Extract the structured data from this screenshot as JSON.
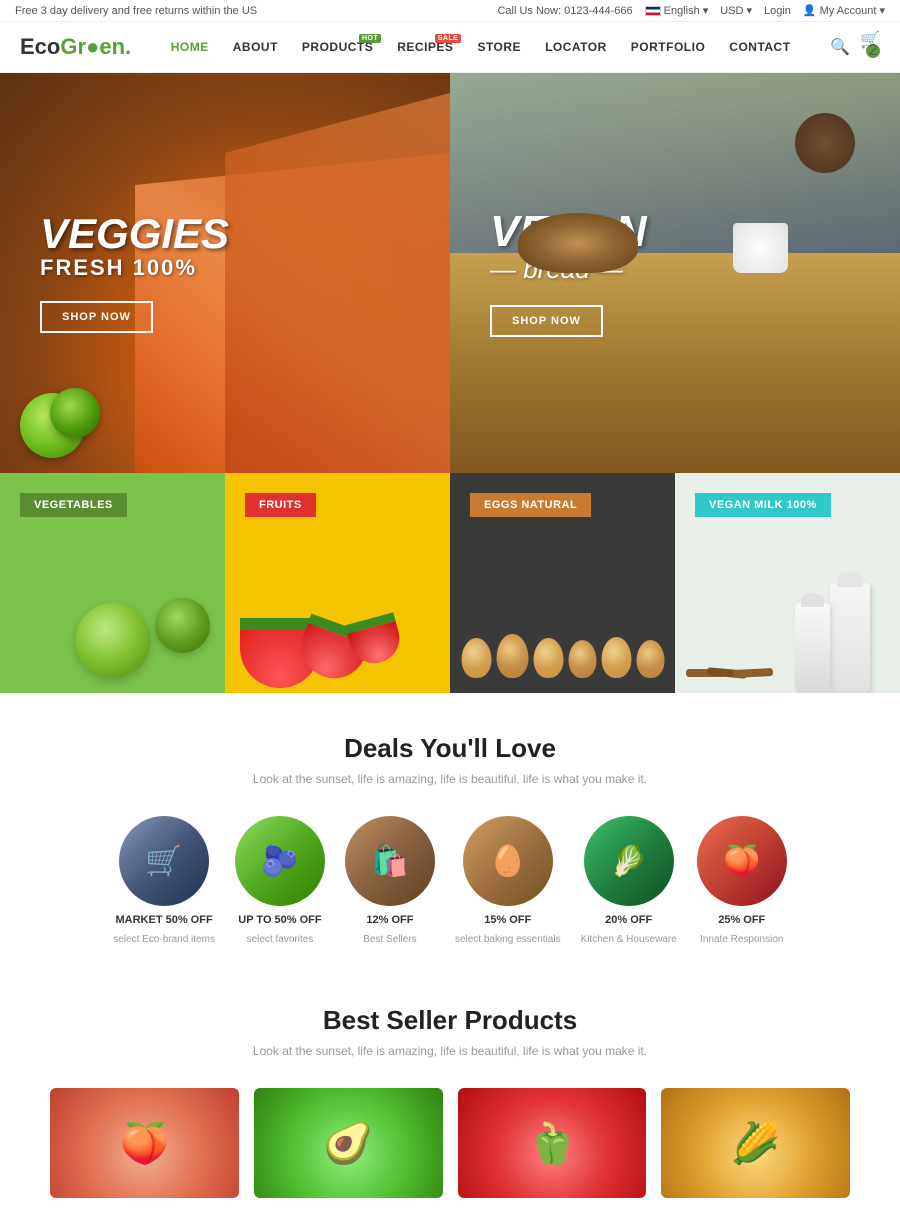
{
  "topbar": {
    "promo": "Free 3 day delivery and free returns within the US",
    "phone_label": "Call Us Now: 0123-444-666",
    "language": "English",
    "currency": "USD",
    "login": "Login",
    "my_account": "My Account"
  },
  "header": {
    "logo": "EcoGreen.",
    "nav": [
      {
        "label": "HOME",
        "active": true,
        "badge": null
      },
      {
        "label": "ABOUT",
        "active": false,
        "badge": null
      },
      {
        "label": "PRODUCTS",
        "active": false,
        "badge": "HOT"
      },
      {
        "label": "RECIPES",
        "active": false,
        "badge": "SALE"
      },
      {
        "label": "STORE",
        "active": false,
        "badge": null
      },
      {
        "label": "LOCATOR",
        "active": false,
        "badge": null
      },
      {
        "label": "PORTFOLIO",
        "active": false,
        "badge": null
      },
      {
        "label": "CONTACT",
        "active": false,
        "badge": null
      }
    ],
    "cart_count": "2"
  },
  "hero": {
    "left": {
      "title": "VEGGIES",
      "subtitle": "FRESH 100%",
      "cta": "SHOP NOW"
    },
    "right": {
      "title": "VEGAN",
      "subtitle": "— bread —",
      "cta": "SHOP NOW"
    }
  },
  "categories": [
    {
      "label": "VEGETABLES",
      "color": "#5a8c30"
    },
    {
      "label": "FRUITS",
      "color": "#e03030"
    },
    {
      "label": "EGGS NATURAL",
      "color": "#c87a30"
    },
    {
      "label": "VEGAN MILK 100%",
      "color": "#30c8c8"
    }
  ],
  "deals": {
    "title": "Deals You'll Love",
    "subtitle": "Look at the sunset, life is amazing, life is beautiful, life is what you make it.",
    "items": [
      {
        "label": "MARKET 50% OFF",
        "sublabel": "select Eco-brand items",
        "emoji": "🛒"
      },
      {
        "label": "UP TO 50% OFF",
        "sublabel": "select favorites",
        "emoji": "🫐"
      },
      {
        "label": "12% OFF",
        "sublabel": "Best Sellers",
        "emoji": "🛍️"
      },
      {
        "label": "15% OFF",
        "sublabel": "select baking essentials",
        "emoji": "🥚"
      },
      {
        "label": "20% OFF",
        "sublabel": "Kitchen & Houseware",
        "emoji": "🥬"
      },
      {
        "label": "25% OFF",
        "sublabel": "Innate Responsion",
        "emoji": "🍑"
      }
    ]
  },
  "bestsellers": {
    "title": "Best Seller Products",
    "subtitle": "Look at the sunset, life is amazing, life is beautiful, life is what you make it."
  }
}
